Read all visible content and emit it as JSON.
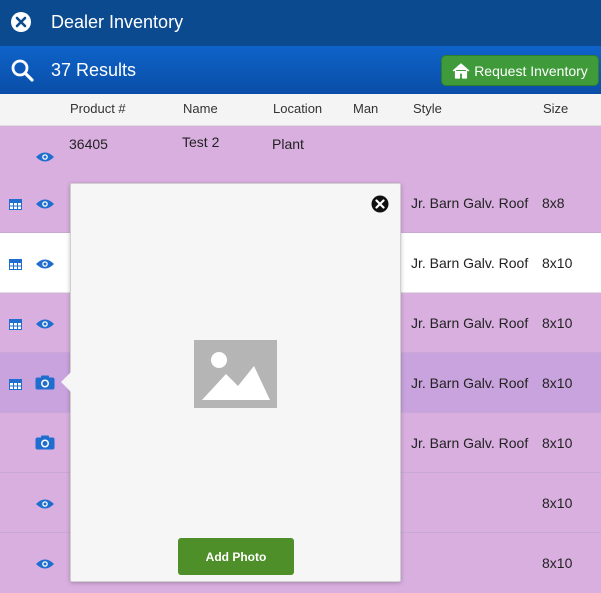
{
  "header": {
    "title": "Dealer Inventory",
    "close_icon": "close-circle-icon"
  },
  "toolbar": {
    "results": "37 Results",
    "search_icon": "search-icon",
    "request_label": "Request Inventory",
    "request_icon": "home-icon",
    "request_color": "#3f9b3a"
  },
  "table": {
    "columns": [
      "Product #",
      "Name",
      "Location",
      "Man",
      "Style",
      "Size"
    ],
    "rows": [
      {
        "product": "36405",
        "name": "Test 2",
        "location": "Plant",
        "man": "",
        "style": "",
        "size": "",
        "icons": [
          "eye-icon"
        ]
      },
      {
        "product": "",
        "name": "",
        "location": "",
        "man": "",
        "style": "Jr. Barn Galv. Roof",
        "size": "8x8",
        "icons": [
          "grid-icon",
          "eye-icon"
        ]
      },
      {
        "product": "",
        "name": "",
        "location": "",
        "man": "",
        "style": "Jr. Barn Galv. Roof",
        "size": "8x10",
        "icons": [
          "grid-icon",
          "eye-icon"
        ]
      },
      {
        "product": "",
        "name": "",
        "location": "",
        "man": "",
        "style": "Jr. Barn Galv. Roof",
        "size": "8x10",
        "icons": [
          "grid-icon",
          "eye-icon"
        ]
      },
      {
        "product": "",
        "name": "",
        "location": "",
        "man": "",
        "style": "Jr. Barn Galv. Roof",
        "size": "8x10",
        "icons": [
          "grid-icon",
          "camera-icon"
        ]
      },
      {
        "product": "",
        "name": "",
        "location": "",
        "man": "",
        "style": "Jr. Barn Galv. Roof",
        "size": "8x10",
        "icons": [
          "camera-icon"
        ]
      },
      {
        "product": "",
        "name": "",
        "location": "",
        "man": "",
        "style": "",
        "size": "8x10",
        "icons": [
          "eye-icon"
        ]
      },
      {
        "product": "",
        "name": "",
        "location": "",
        "man": "",
        "style": "",
        "size": "8x10",
        "icons": [
          "eye-icon"
        ]
      }
    ]
  },
  "popup": {
    "add_photo_label": "Add Photo",
    "close_icon": "close-circle-icon",
    "image_icon": "image-placeholder-icon"
  },
  "colors": {
    "titlebar": "#0b4a8f",
    "results_bar": "#0e63c9",
    "row_purple": "#d9afe0",
    "row_selected": "#c9a3dd",
    "add_photo": "#4e8f2a",
    "icon_blue": "#1f6ecf"
  }
}
